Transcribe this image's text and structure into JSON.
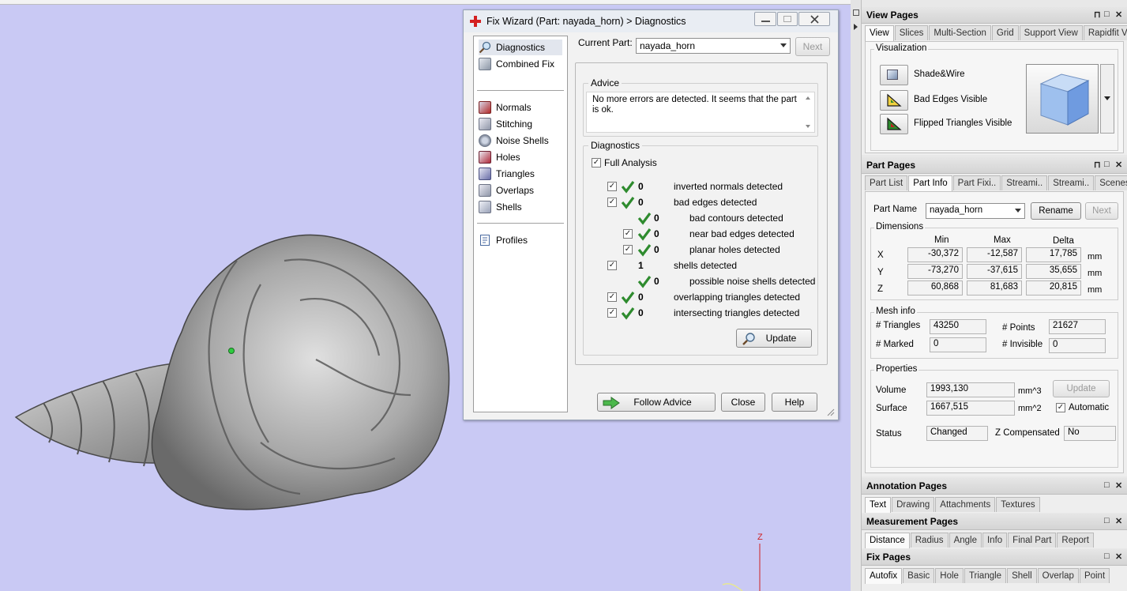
{
  "dialog": {
    "title": "Fix Wizard (Part: nayada_horn) > Diagnostics",
    "nav": {
      "top": [
        "Diagnostics",
        "Combined Fix"
      ],
      "mid": [
        "Normals",
        "Stitching",
        "Noise Shells",
        "Holes",
        "Triangles",
        "Overlaps",
        "Shells"
      ],
      "bottom": [
        "Profiles"
      ]
    },
    "current_part_label": "Current Part:",
    "current_part_value": "nayada_horn",
    "next_label": "Next",
    "advice_title": "Advice",
    "advice_text": "No more errors are detected. It seems that the part is ok.",
    "diagnostics_title": "Diagnostics",
    "full_analysis_label": "Full Analysis",
    "rows": [
      {
        "count": "0",
        "label": "inverted normals detected"
      },
      {
        "count": "0",
        "label": "bad edges detected"
      },
      {
        "count": "0",
        "label": "bad contours detected"
      },
      {
        "count": "0",
        "label": "near bad edges detected"
      },
      {
        "count": "0",
        "label": "planar holes detected"
      },
      {
        "count": "1",
        "label": "shells detected"
      },
      {
        "count": "0",
        "label": "possible noise shells detected"
      },
      {
        "count": "0",
        "label": "overlapping triangles detected"
      },
      {
        "count": "0",
        "label": "intersecting triangles detected"
      }
    ],
    "update_label": "Update",
    "follow_advice_label": "Follow Advice",
    "close_label": "Close",
    "help_label": "Help"
  },
  "view_pages": {
    "title": "View Pages",
    "tabs": [
      "View",
      "Slices",
      "Multi-Section",
      "Grid",
      "Support View",
      "Rapidfit View"
    ],
    "visualization_title": "Visualization",
    "items": [
      "Shade&Wire",
      "Bad Edges Visible",
      "Flipped Triangles Visible"
    ]
  },
  "part_pages": {
    "title": "Part Pages",
    "tabs": [
      "Part List",
      "Part Info",
      "Part Fixi..",
      "Streami..",
      "Streami..",
      "Scenes"
    ],
    "part_name_label": "Part Name",
    "part_name_value": "nayada_horn",
    "rename_label": "Rename",
    "next_label": "Next",
    "dimensions_title": "Dimensions",
    "dim_headers": [
      "Min",
      "Max",
      "Delta"
    ],
    "dims": [
      {
        "axis": "X",
        "min": "-30,372",
        "max": "-12,587",
        "delta": "17,785",
        "unit": "mm"
      },
      {
        "axis": "Y",
        "min": "-73,270",
        "max": "-37,615",
        "delta": "35,655",
        "unit": "mm"
      },
      {
        "axis": "Z",
        "min": "60,868",
        "max": "81,683",
        "delta": "20,815",
        "unit": "mm"
      }
    ],
    "mesh_title": "Mesh info",
    "triangles_label": "# Triangles",
    "triangles_value": "43250",
    "points_label": "# Points",
    "points_value": "21627",
    "marked_label": "# Marked",
    "marked_value": "0",
    "invisible_label": "# Invisible",
    "invisible_value": "0",
    "properties_title": "Properties",
    "volume_label": "Volume",
    "volume_value": "1993,130",
    "volume_unit": "mm^3",
    "update_label": "Update",
    "surface_label": "Surface",
    "surface_value": "1667,515",
    "surface_unit": "mm^2",
    "automatic_label": "Automatic",
    "status_label": "Status",
    "status_value": "Changed",
    "zcomp_label": "Z Compensated",
    "zcomp_value": "No"
  },
  "annotation_pages": {
    "title": "Annotation Pages",
    "tabs": [
      "Text",
      "Drawing",
      "Attachments",
      "Textures"
    ]
  },
  "measurement_pages": {
    "title": "Measurement Pages",
    "tabs": [
      "Distance",
      "Radius",
      "Angle",
      "Info",
      "Final Part",
      "Report"
    ]
  },
  "fix_pages": {
    "title": "Fix Pages",
    "tabs": [
      "Autofix",
      "Basic",
      "Hole",
      "Triangle",
      "Shell",
      "Overlap",
      "Point"
    ]
  },
  "axis_label": "Z",
  "colors": {
    "viewport_bg": "#c9c9f4",
    "check_green": "#2e8b2e",
    "title_red": "#d42020"
  }
}
